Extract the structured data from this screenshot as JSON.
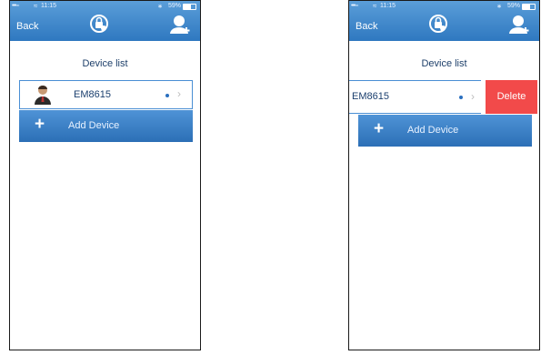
{
  "status_bar": {
    "signal": "•••◦◦",
    "time": "11:15",
    "bluetooth": "∗",
    "battery_pct": "59%"
  },
  "nav": {
    "back_label": "Back",
    "center_icon": "device-lock-icon",
    "right_icon": "add-user-icon"
  },
  "page_title": "Device list",
  "device": {
    "name": "EM8615",
    "avatar_icon": "person-avatar-icon",
    "status_icon": "online-dot-icon",
    "chevron": "›"
  },
  "add_device": {
    "icon": "+",
    "label": "Add Device"
  },
  "swipe_actions": {
    "delete_label": "Delete"
  },
  "colors": {
    "nav_blue": "#3d86cd",
    "delete_red": "#f24a4a",
    "text_blue": "#1b3f6e"
  }
}
